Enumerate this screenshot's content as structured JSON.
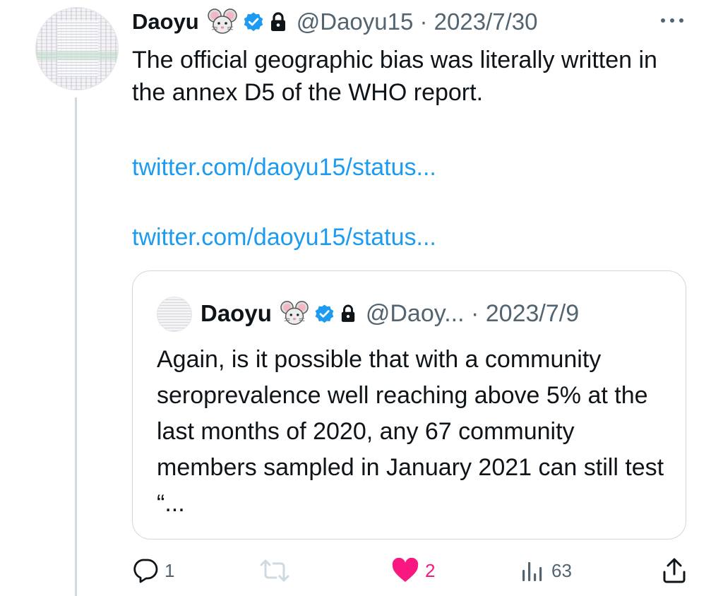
{
  "tweet": {
    "author_name": "Daoyu",
    "handle_date": "@Daoyu15 · 2023/7/30",
    "text": "The official geographic bias was literally written in the annex D5 of the WHO report.",
    "links": [
      "twitter.com/daoyu15/status...",
      "twitter.com/daoyu15/status..."
    ]
  },
  "quoted": {
    "author_name": "Daoyu",
    "handle_date": "@Daoy... · 2023/7/9",
    "text": "Again, is it possible that with a community seroprevalence well reaching above 5% at the last months of 2020, any 67 community members sampled in January 2021 can still test “..."
  },
  "actions": {
    "reply_count": "1",
    "retweet_count": "",
    "like_count": "2",
    "views_count": "63"
  },
  "colors": {
    "link": "#1d9bf0",
    "muted": "#536471",
    "like": "#f91880",
    "verified": "#1d9bf0",
    "border": "#cfd9de"
  },
  "icons": {
    "author_emoji": "mouse-face-icon",
    "verified": "verified-badge-icon",
    "protected": "lock-icon",
    "more": "more-dots-icon",
    "reply": "reply-bubble-icon",
    "retweet": "retweet-icon",
    "like": "heart-icon",
    "views": "views-bars-icon",
    "share": "share-icon"
  }
}
